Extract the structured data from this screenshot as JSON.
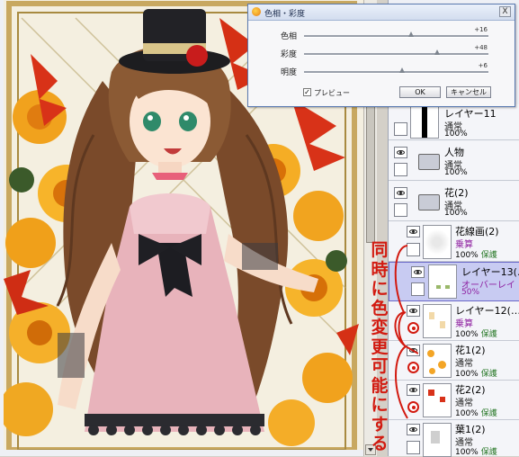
{
  "dialog": {
    "title": "色相・彩度",
    "close_glyph": "X",
    "sliders": [
      {
        "label": "色相",
        "value": "+16",
        "fraction": 0.58
      },
      {
        "label": "彩度",
        "value": "+48",
        "fraction": 0.72
      },
      {
        "label": "明度",
        "value": "+6",
        "fraction": 0.53
      }
    ],
    "preview_label": "プレビュー",
    "preview_checked": true,
    "ok_label": "OK",
    "cancel_label": "キャンセル"
  },
  "layers": [
    {
      "name": "レイヤー11",
      "mode": "通常",
      "opacity": "100%",
      "protect": ""
    },
    {
      "name": "人物",
      "mode": "通常",
      "opacity": "100%",
      "protect": "",
      "folder": true
    },
    {
      "name": "花(2)",
      "mode": "通常",
      "opacity": "100%",
      "protect": "",
      "folder": true
    },
    {
      "name": "花線画(2)",
      "mode": "乗算",
      "opacity": "100%",
      "protect": "保護"
    },
    {
      "name": "レイヤー13(…",
      "mode": "オーバーレイ",
      "opacity": "50%",
      "protect": "",
      "selected": true
    },
    {
      "name": "レイヤー12(…",
      "mode": "乗算",
      "opacity": "100%",
      "protect": "保護"
    },
    {
      "name": "花1(2)",
      "mode": "通常",
      "opacity": "100%",
      "protect": "保護"
    },
    {
      "name": "花2(2)",
      "mode": "通常",
      "opacity": "100%",
      "protect": "保護"
    },
    {
      "name": "葉1(2)",
      "mode": "通常",
      "opacity": "100%",
      "protect": "保護"
    }
  ],
  "annotation": {
    "text": "同時に色変更可能にする",
    "color": "#d21a10"
  }
}
